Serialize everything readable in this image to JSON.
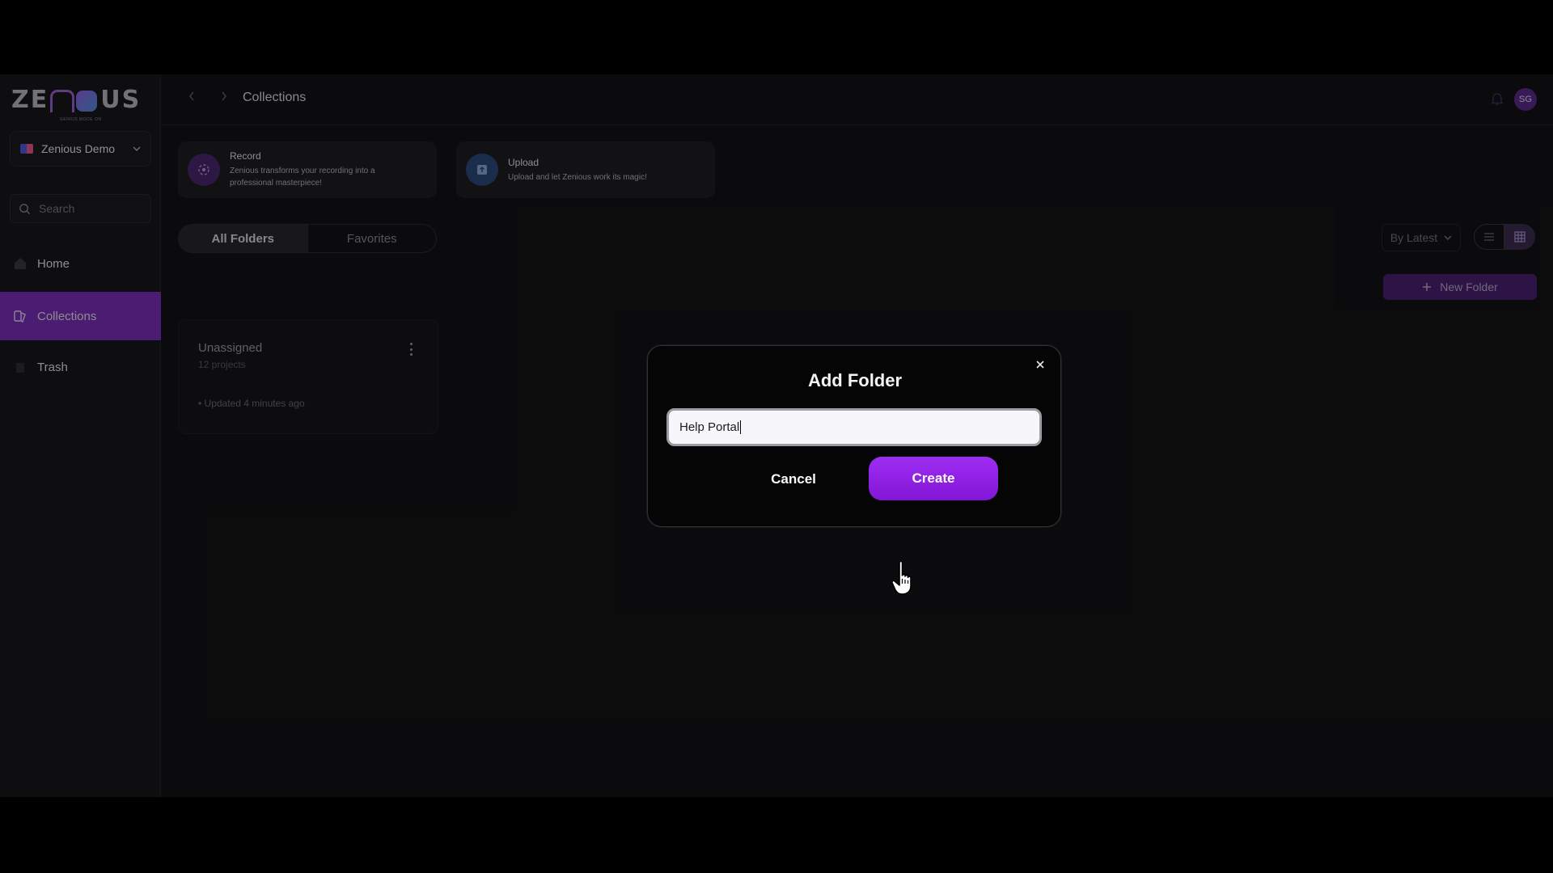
{
  "app": {
    "logo_text_left": "ZE",
    "logo_text_right": "US",
    "logo_tagline": "GENIUS MODE ON",
    "colors": {
      "accent": "#7a2fb8",
      "create_button": "#9e2df2",
      "background": "#131315"
    }
  },
  "sidebar": {
    "workspace": {
      "name": "Zenious Demo",
      "icon": "workspace-flag-icon"
    },
    "search": {
      "placeholder": "Search",
      "icon": "search-icon"
    },
    "items": [
      {
        "label": "Home",
        "icon": "home-icon",
        "active": false
      },
      {
        "label": "Collections",
        "icon": "collections-icon",
        "active": true
      },
      {
        "label": "Trash",
        "icon": "trash-icon",
        "active": false
      }
    ]
  },
  "header": {
    "title": "Collections",
    "back_icon": "chevron-left-icon",
    "forward_icon": "chevron-right-icon",
    "notifications_icon": "bell-icon",
    "avatar_initials": "SG"
  },
  "actions": [
    {
      "title": "Record",
      "description": "Zenious transforms your recording into a professional masterpiece!",
      "icon": "record-icon"
    },
    {
      "title": "Upload",
      "description": "Upload and let Zenious work its magic!",
      "icon": "upload-icon"
    }
  ],
  "tabs": [
    {
      "label": "All Folders",
      "active": true
    },
    {
      "label": "Favorites",
      "active": false
    }
  ],
  "toolbar": {
    "sort_label": "By Latest",
    "view_modes": [
      "list",
      "grid"
    ],
    "active_view": "grid",
    "new_folder_label": "New Folder"
  },
  "folders": [
    {
      "name": "Unassigned",
      "count": "12 projects",
      "updated": "• Updated 4 minutes ago"
    }
  ],
  "modal": {
    "title": "Add Folder",
    "input_value": "Help Portal",
    "cancel_label": "Cancel",
    "create_label": "Create"
  }
}
